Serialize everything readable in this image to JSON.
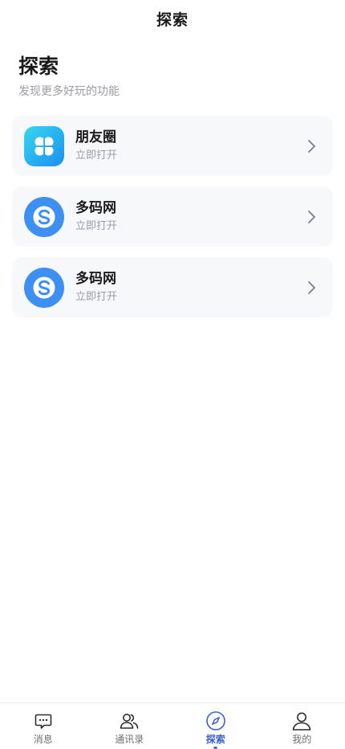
{
  "nav": {
    "title": "探索"
  },
  "header": {
    "title": "探索",
    "subtitle": "发现更多好玩的功能"
  },
  "cards": [
    {
      "title": "朋友圈",
      "subtitle": "立即打开",
      "icon": "clover-app-icon"
    },
    {
      "title": "多码网",
      "subtitle": "立即打开",
      "icon": "skype-s-icon"
    },
    {
      "title": "多码网",
      "subtitle": "立即打开",
      "icon": "skype-s-icon"
    }
  ],
  "tabs": [
    {
      "label": "消息",
      "icon": "chat-bubble-icon",
      "active": false
    },
    {
      "label": "通讯录",
      "icon": "contacts-icon",
      "active": false
    },
    {
      "label": "探索",
      "icon": "compass-icon",
      "active": true
    },
    {
      "label": "我的",
      "icon": "user-icon",
      "active": false
    }
  ],
  "colors": {
    "accent": "#3a5fcf",
    "card_bg": "#f7f8fb",
    "skype_blue": "#3d8ff2",
    "clover_gradient_start": "#37d8ee",
    "clover_gradient_end": "#1b8ef2"
  }
}
